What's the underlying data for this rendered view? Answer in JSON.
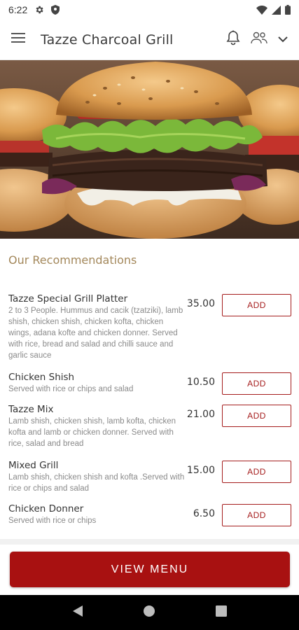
{
  "status_bar": {
    "time": "6:22",
    "icons": [
      "settings-icon",
      "shield-icon",
      "wifi-icon",
      "signal-icon",
      "battery-icon"
    ]
  },
  "app_bar": {
    "title": "Tazze Charcoal Grill",
    "icons": [
      "menu-icon",
      "bell-icon",
      "users-icon",
      "chevron-down-icon"
    ]
  },
  "hero": {
    "image": "burger-photo"
  },
  "recommendations": {
    "title": "Our Recommendations",
    "add_label": "ADD",
    "items": [
      {
        "name": "Tazze Special Grill Platter",
        "description": "2 to 3 People. Hummus and cacik (tzatziki), lamb shish, chicken shish, chicken kofta, chicken wings, adana kofte and chicken donner. Served with rice, bread and salad and chilli sauce and garlic sauce",
        "price": "35.00"
      },
      {
        "name": "Chicken Shish",
        "description": "Served with rice or chips and salad",
        "price": "10.50"
      },
      {
        "name": "Tazze Mix",
        "description": "Lamb shish, chicken shish, lamb kofta, chicken kofta and lamb or chicken donner. Served with rice, salad and bread",
        "price": "21.00"
      },
      {
        "name": "Mixed Grill",
        "description": "Lamb shish, chicken shish and kofta .Served with rice or chips and salad",
        "price": "15.00"
      },
      {
        "name": "Chicken Donner",
        "description": "Served with rice or chips",
        "price": "6.50"
      }
    ]
  },
  "footer": {
    "view_menu_label": "VIEW MENU"
  },
  "nav_bar": {
    "icons": [
      "back-icon",
      "home-icon",
      "recents-icon"
    ]
  },
  "colors": {
    "accent": "#a81111",
    "section_title": "#a3875a"
  }
}
